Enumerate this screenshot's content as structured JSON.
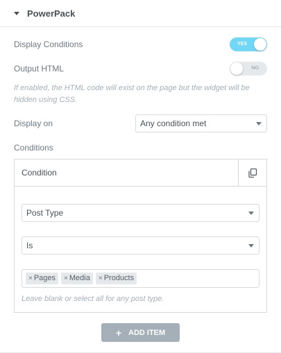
{
  "section": {
    "title": "PowerPack"
  },
  "display_conditions": {
    "label": "Display Conditions",
    "toggle_text": "YES",
    "enabled": true
  },
  "output_html": {
    "label": "Output HTML",
    "toggle_text": "NO",
    "enabled": false
  },
  "description": "If enabled, the HTML code will exist on the page but the widget will be hidden using CSS.",
  "display_on": {
    "label": "Display on",
    "value": "Any condition met"
  },
  "conditions": {
    "label": "Conditions",
    "item_title": "Condition",
    "rule_type": "Post Type",
    "operator": "Is",
    "tags": [
      "Pages",
      "Media",
      "Products"
    ],
    "tag_remove_glyph": "×",
    "hint": "Leave blank or select all for any post type."
  },
  "add_item": {
    "plus": "+",
    "label": "ADD ITEM"
  },
  "icons": {
    "caret": "caret-down-icon",
    "duplicate": "duplicate-icon",
    "dropdown": "dropdown-arrow-icon"
  },
  "colors": {
    "toggle_on": "#71d7f7",
    "toggle_off": "#e6e9ec",
    "button": "#a4afb7"
  }
}
